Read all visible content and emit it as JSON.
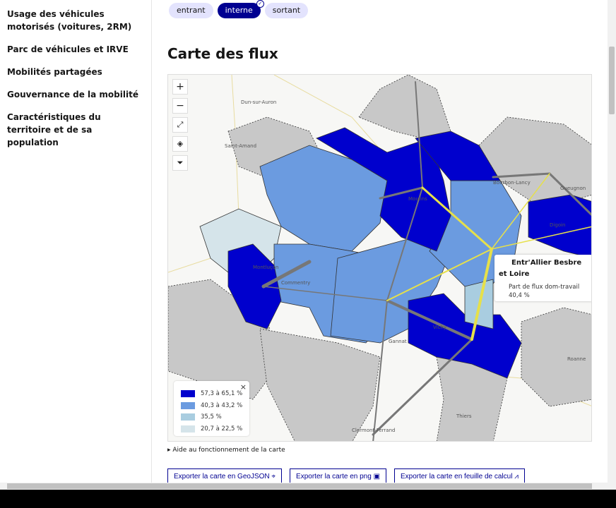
{
  "sidebar": {
    "items": [
      {
        "label": "Usage des véhicules motorisés (voitures, 2RM)"
      },
      {
        "label": "Parc de véhicules et IRVE"
      },
      {
        "label": "Mobilités partagées"
      },
      {
        "label": "Gouvernance de la mobilité"
      },
      {
        "label": "Caractéristiques du territoire et de sa population"
      }
    ]
  },
  "filters": {
    "chips": [
      {
        "label": "entrant",
        "selected": false
      },
      {
        "label": "interne",
        "selected": true
      },
      {
        "label": "sortant",
        "selected": false
      }
    ]
  },
  "section_title": "Carte des flux",
  "map": {
    "controls": {
      "zoom_in": "+",
      "zoom_out": "−",
      "fullscreen": "⤢",
      "layers": "◈",
      "filter": "⏷"
    },
    "place_labels": [
      "Dun-sur-Auron",
      "Saint-Amand",
      "Moulins",
      "Montluçon",
      "Commentry",
      "Vichy",
      "Gannat",
      "Digoin",
      "Bourbon-Lancy",
      "Gueugnon",
      "Roanne",
      "Thiers",
      "Clermont-Ferrand"
    ],
    "legend": {
      "close": "×",
      "items": [
        {
          "label": "57,3 à 65,1 %",
          "color": "#0000cd"
        },
        {
          "label": "40,3 à 43,2 %",
          "color": "#6b9be0"
        },
        {
          "label": "35,5 %",
          "color": "#a9cde0"
        },
        {
          "label": "20,7 à 22,5 %",
          "color": "#d5e4ea"
        }
      ]
    },
    "tooltip": {
      "title": "Entr'Allier Besbre et Loire",
      "label": "Part de flux dom-travail",
      "value": "40,4 %"
    },
    "colors": {
      "outside": "#c8c8c8",
      "highlight_flow": "#e6e04a",
      "flow": "#777777"
    }
  },
  "help_link": "Aide au fonctionnement de la carte",
  "exports": [
    {
      "label": "Exporter la carte en GeoJSON",
      "icon": "map-pin-icon"
    },
    {
      "label": "Exporter la carte en png",
      "icon": "image-icon"
    },
    {
      "label": "Exporter la carte en feuille de calcul",
      "icon": "chart-icon"
    }
  ]
}
